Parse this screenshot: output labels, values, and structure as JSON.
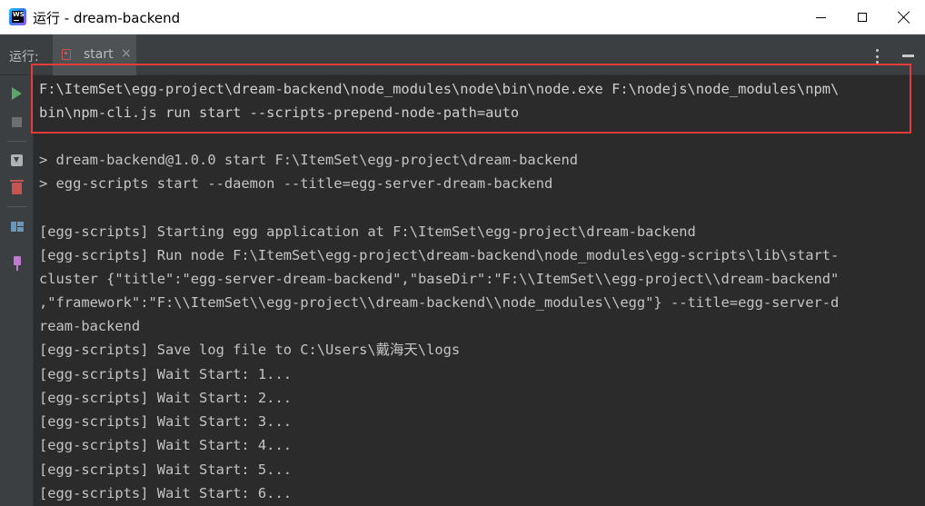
{
  "window": {
    "title": "运行 - dream-backend",
    "app_icon_text": "WS"
  },
  "run_panel": {
    "label": "运行:",
    "tab": {
      "label": "start",
      "close": "×"
    }
  },
  "toolbar": {
    "items": [
      "rerun-icon",
      "stop-icon",
      "scroll-to-end-icon",
      "clear-icon",
      "layout-icon",
      "pin-icon"
    ]
  },
  "console": {
    "lines": [
      "F:\\ItemSet\\egg-project\\dream-backend\\node_modules\\node\\bin\\node.exe F:\\nodejs\\node_modules\\npm\\",
      "bin\\npm-cli.js run start --scripts-prepend-node-path=auto",
      "",
      "> dream-backend@1.0.0 start F:\\ItemSet\\egg-project\\dream-backend",
      "> egg-scripts start --daemon --title=egg-server-dream-backend",
      "",
      "[egg-scripts] Starting egg application at F:\\ItemSet\\egg-project\\dream-backend",
      "[egg-scripts] Run node F:\\ItemSet\\egg-project\\dream-backend\\node_modules\\egg-scripts\\lib\\start-",
      "cluster {\"title\":\"egg-server-dream-backend\",\"baseDir\":\"F:\\\\ItemSet\\\\egg-project\\\\dream-backend\"",
      ",\"framework\":\"F:\\\\ItemSet\\\\egg-project\\\\dream-backend\\\\node_modules\\\\egg\"} --title=egg-server-d",
      "ream-backend",
      "[egg-scripts] Save log file to C:\\Users\\戴海天\\logs",
      "[egg-scripts] Wait Start: 1...",
      "[egg-scripts] Wait Start: 2...",
      "[egg-scripts] Wait Start: 3...",
      "[egg-scripts] Wait Start: 4...",
      "[egg-scripts] Wait Start: 5...",
      "[egg-scripts] Wait Start: 6..."
    ]
  },
  "colors": {
    "highlight_border": "#e63b3b",
    "console_bg": "#2b2b2b",
    "run_green": "#59a869"
  }
}
